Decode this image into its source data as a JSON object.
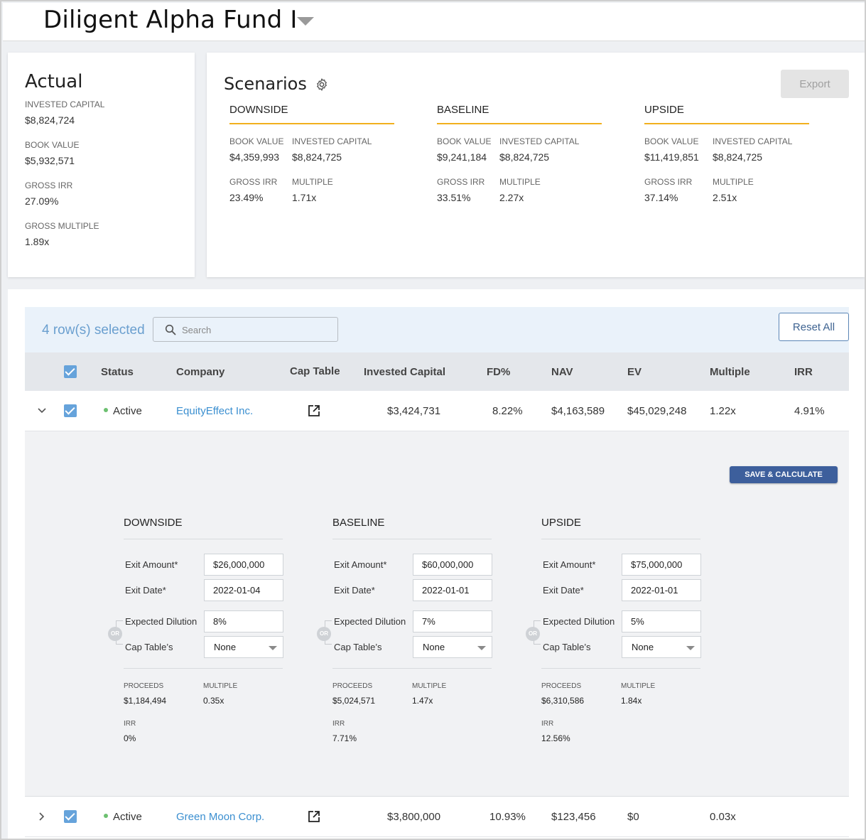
{
  "header": {
    "fund_name": "Diligent Alpha Fund I"
  },
  "actual": {
    "title": "Actual",
    "metrics": [
      {
        "label": "INVESTED CAPITAL",
        "value": "$8,824,724"
      },
      {
        "label": "BOOK VALUE",
        "value": "$5,932,571"
      },
      {
        "label": "GROSS IRR",
        "value": "27.09%"
      },
      {
        "label": "GROSS MULTIPLE",
        "value": "1.89x"
      }
    ]
  },
  "scenarios": {
    "title": "Scenarios",
    "export_label": "Export",
    "items": [
      {
        "name": "DOWNSIDE",
        "book_value_label": "BOOK VALUE",
        "book_value": "$4,359,993",
        "invested_label": "INVESTED CAPITAL",
        "invested": "$8,824,725",
        "irr_label": "GROSS IRR",
        "irr": "23.49%",
        "multiple_label": "MULTIPLE",
        "multiple": "1.71x"
      },
      {
        "name": "BASELINE",
        "book_value_label": "BOOK VALUE",
        "book_value": "$9,241,184",
        "invested_label": "INVESTED CAPITAL",
        "invested": "$8,824,725",
        "irr_label": "GROSS IRR",
        "irr": "33.51%",
        "multiple_label": "MULTIPLE",
        "multiple": "2.27x"
      },
      {
        "name": "UPSIDE",
        "book_value_label": "BOOK VALUE",
        "book_value": "$11,419,851",
        "invested_label": "INVESTED CAPITAL",
        "invested": "$8,824,725",
        "irr_label": "GROSS IRR",
        "irr": "37.14%",
        "multiple_label": "MULTIPLE",
        "multiple": "2.51x"
      }
    ]
  },
  "table": {
    "rows_selected": "4 row(s) selected",
    "search_placeholder": "Search",
    "reset_label": "Reset All",
    "columns": [
      "Status",
      "Company",
      "Cap Table",
      "Invested Capital",
      "FD%",
      "NAV",
      "EV",
      "Multiple",
      "IRR"
    ],
    "rows": [
      {
        "status": "Active",
        "company": "EquityEffect Inc.",
        "invested": "$3,424,731",
        "fd": "8.22%",
        "nav": "$4,163,589",
        "ev": "$45,029,248",
        "multiple": "1.22x",
        "irr": "4.91%"
      },
      {
        "status": "Active",
        "company": "Green Moon Corp.",
        "invested": "$3,800,000",
        "fd": "10.93%",
        "nav": "$123,456",
        "ev": "$0",
        "multiple": "0.03x",
        "irr": ""
      }
    ]
  },
  "expanded": {
    "save_label": "SAVE & CALCULATE",
    "labels": {
      "exit_amount": "Exit Amount*",
      "exit_date": "Exit Date*",
      "dilution": "Expected Dilution",
      "cap_tables": "Cap Table’s",
      "or": "OR",
      "proceeds": "PROCEEDS",
      "multiple": "MULTIPLE",
      "irr": "IRR"
    },
    "scenarios": [
      {
        "name": "DOWNSIDE",
        "exit_amount": "$26,000,000",
        "exit_date": "2022-01-04",
        "dilution": "8%",
        "cap_table": "None",
        "proceeds": "$1,184,494",
        "multiple": "0.35x",
        "irr": "0%"
      },
      {
        "name": "BASELINE",
        "exit_amount": "$60,000,000",
        "exit_date": "2022-01-01",
        "dilution": "7%",
        "cap_table": "None",
        "proceeds": "$5,024,571",
        "multiple": "1.47x",
        "irr": "7.71%"
      },
      {
        "name": "UPSIDE",
        "exit_amount": "$75,000,000",
        "exit_date": "2022-01-01",
        "dilution": "5%",
        "cap_table": "None",
        "proceeds": "$6,310,586",
        "multiple": "1.84x",
        "irr": "12.56%"
      }
    ]
  },
  "colors": {
    "accent": "#f2b01e",
    "link": "#3b8fd0",
    "checkbox": "#66a3db",
    "primary_button": "#3d5f9c",
    "status_active": "#6cc070"
  }
}
